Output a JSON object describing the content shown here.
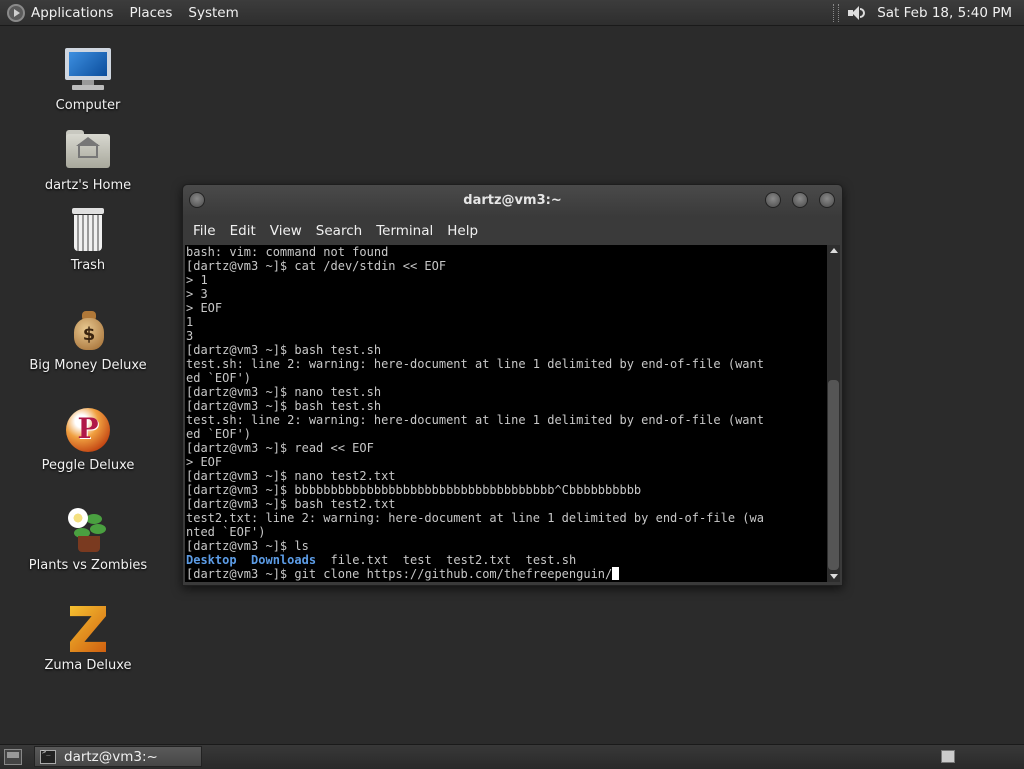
{
  "top_panel": {
    "menus": [
      "Applications",
      "Places",
      "System"
    ],
    "clock": "Sat Feb 18,  5:40 PM"
  },
  "desktop_icons": [
    {
      "label": "Computer",
      "icon": "computer-icon"
    },
    {
      "label": "dartz's Home",
      "icon": "home-folder-icon"
    },
    {
      "label": "Trash",
      "icon": "trash-icon"
    },
    {
      "label": "Big Money Deluxe",
      "icon": "money-bag-icon"
    },
    {
      "label": "Peggle Deluxe",
      "icon": "peggle-icon"
    },
    {
      "label": "Plants vs Zombies",
      "icon": "plants-vs-zombies-icon"
    },
    {
      "label": "Zuma Deluxe",
      "icon": "zuma-icon"
    }
  ],
  "terminal": {
    "title": "dartz@vm3:~",
    "menus": [
      "File",
      "Edit",
      "View",
      "Search",
      "Terminal",
      "Help"
    ],
    "lines": [
      "bash: vim: command not found",
      "[dartz@vm3 ~]$ cat /dev/stdin << EOF",
      "> 1",
      "> 3",
      "> EOF",
      "1",
      "3",
      "[dartz@vm3 ~]$ bash test.sh",
      "test.sh: line 2: warning: here-document at line 1 delimited by end-of-file (want",
      "ed `EOF')",
      "[dartz@vm3 ~]$ nano test.sh",
      "[dartz@vm3 ~]$ bash test.sh",
      "test.sh: line 2: warning: here-document at line 1 delimited by end-of-file (want",
      "ed `EOF')",
      "[dartz@vm3 ~]$ read << EOF",
      "> EOF",
      "[dartz@vm3 ~]$ nano test2.txt",
      "[dartz@vm3 ~]$ bbbbbbbbbbbbbbbbbbbbbbbbbbbbbbbbbbbb^Cbbbbbbbbbb",
      "[dartz@vm3 ~]$ bash test2.txt",
      "test2.txt: line 2: warning: here-document at line 1 delimited by end-of-file (wa",
      "nted `EOF')",
      "[dartz@vm3 ~]$ ls"
    ],
    "ls_output": {
      "dirs": [
        "Desktop",
        "Downloads"
      ],
      "files": [
        "file.txt",
        "test",
        "test2.txt",
        "test.sh"
      ]
    },
    "prompt_line": "[dartz@vm3 ~]$ git clone https://github.com/thefreepenguin/"
  },
  "taskbar": {
    "window_button": "dartz@vm3:~"
  }
}
